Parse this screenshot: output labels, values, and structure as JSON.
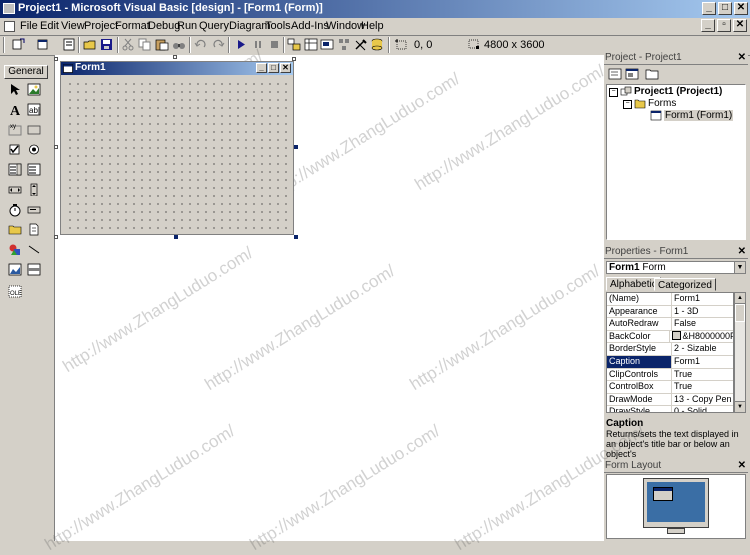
{
  "window": {
    "title": "Project1 - Microsoft Visual Basic [design] - [Form1 (Form)]"
  },
  "caption_buttons": [
    "_",
    "□",
    "✕"
  ],
  "mdi_buttons": [
    "_",
    "▫",
    "✕"
  ],
  "menu": [
    "File",
    "Edit",
    "View",
    "Project",
    "Format",
    "Debug",
    "Run",
    "Query",
    "Diagram",
    "Tools",
    "Add-Ins",
    "Window",
    "Help"
  ],
  "toolbar": {
    "position": "0, 0",
    "size": "4800 x 3600"
  },
  "toolbox": {
    "tab_label": "General"
  },
  "form": {
    "title": "Form1"
  },
  "project_panel": {
    "title": "Project - Project1",
    "tree": {
      "root": "Project1 (Project1)",
      "folder": "Forms",
      "item": "Form1 (Form1)"
    }
  },
  "properties_panel": {
    "title": "Properties - Form1",
    "object_name": "Form1",
    "object_type": "Form",
    "tabs": [
      "Alphabetic",
      "Categorized"
    ],
    "rows": [
      {
        "name": "(Name)",
        "value": "Form1"
      },
      {
        "name": "Appearance",
        "value": "1 - 3D"
      },
      {
        "name": "AutoRedraw",
        "value": "False"
      },
      {
        "name": "BackColor",
        "value": "&H8000000F"
      },
      {
        "name": "BorderStyle",
        "value": "2 - Sizable"
      },
      {
        "name": "Caption",
        "value": "Form1"
      },
      {
        "name": "ClipControls",
        "value": "True"
      },
      {
        "name": "ControlBox",
        "value": "True"
      },
      {
        "name": "DrawMode",
        "value": "13 - Copy Pen"
      },
      {
        "name": "DrawStyle",
        "value": "0 - Solid"
      }
    ],
    "selected_index": 5,
    "desc_title": "Caption",
    "desc_text": "Returns/sets the text displayed in an object's title bar or below an object's"
  },
  "layout_panel": {
    "title": "Form Layout"
  },
  "watermark": "http://www.ZhangLuduo.com/",
  "colors": {
    "title_start": "#0a246a",
    "title_end": "#a6caf0",
    "layout_screen": "#3a6ea5"
  }
}
